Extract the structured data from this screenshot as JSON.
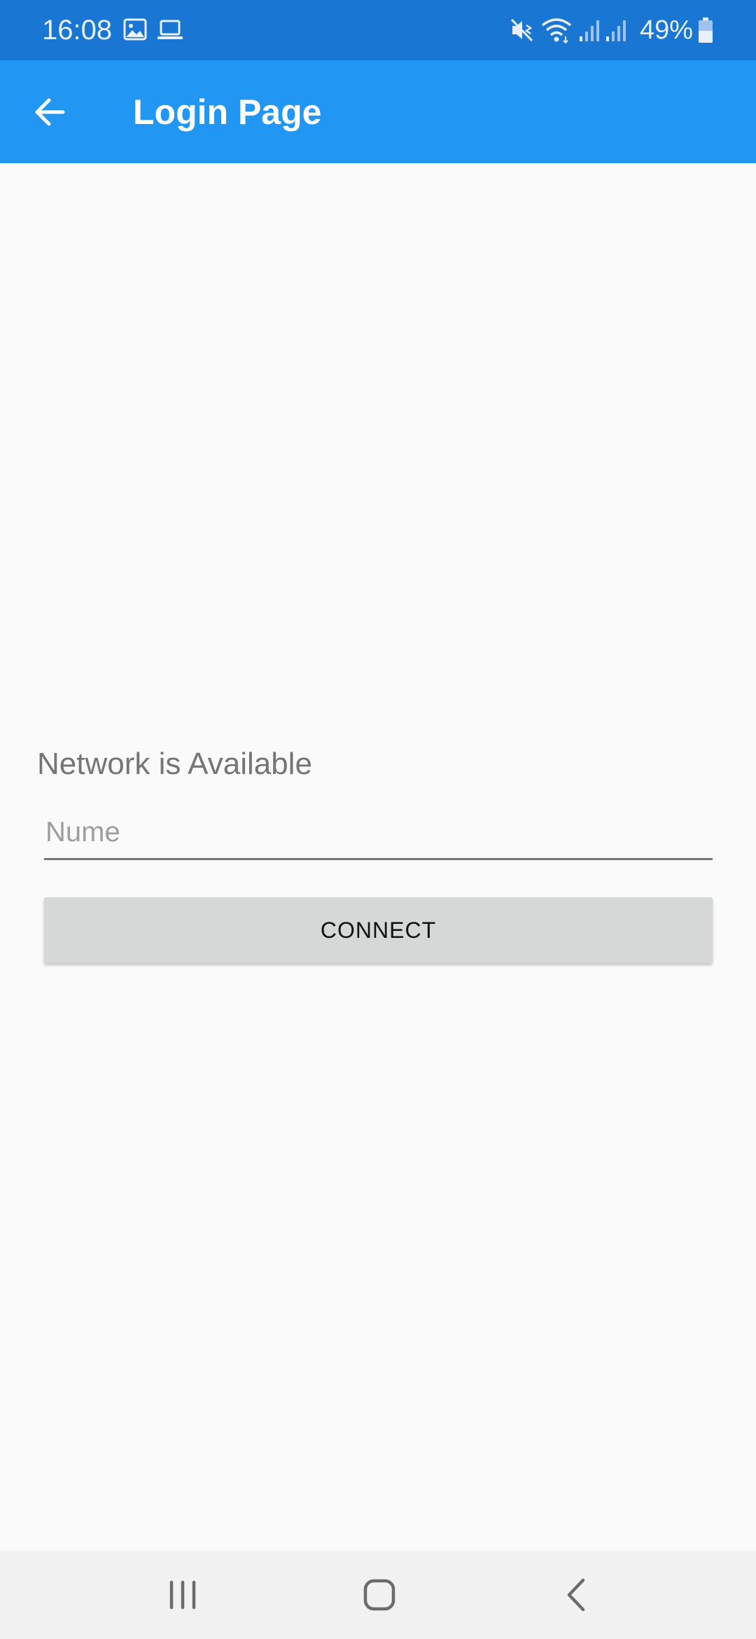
{
  "status_bar": {
    "time": "16:08",
    "battery_percent": "49%",
    "icons_left": [
      "gallery-icon",
      "laptop-icon"
    ],
    "icons_right": [
      "mute-vibrate-icon",
      "wifi-icon",
      "signal-icon",
      "signal-icon-2",
      "battery-icon"
    ],
    "battery_level": 0.49
  },
  "app_bar": {
    "title": "Login Page",
    "back_icon": "arrow-left-icon"
  },
  "main": {
    "network_status": "Network is Available",
    "name_input": {
      "value": "",
      "placeholder": "Nume"
    },
    "connect_label": "CONNECT"
  },
  "nav_bar": {
    "buttons": [
      "recent-apps-icon",
      "home-icon",
      "back-icon"
    ]
  },
  "colors": {
    "status_bar": "#1976d2",
    "app_bar": "#2196f3",
    "background": "#fafafa",
    "button": "#d6d7d7"
  }
}
